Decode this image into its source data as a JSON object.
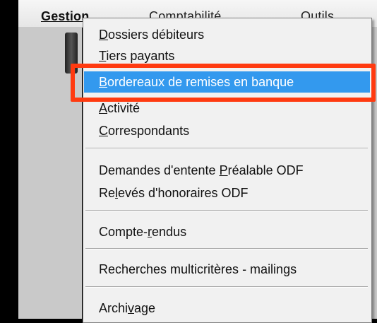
{
  "menubar": {
    "items": [
      {
        "label": "Gestion"
      },
      {
        "label": "Comptabilité"
      },
      {
        "label": "Outils"
      }
    ]
  },
  "menu": {
    "items": [
      {
        "label": "Dossiers débiteurs",
        "underline": "D"
      },
      {
        "label": "Tiers payants",
        "underline": "T"
      },
      {
        "label": "Bordereaux de remises en banque",
        "underline": "B",
        "selected": true
      },
      {
        "label": "Activité",
        "underline": "A"
      },
      {
        "label": "Correspondants",
        "underline": "C"
      },
      {
        "label": "Demandes d'entente Préalable ODF",
        "underline": "P"
      },
      {
        "label": "Relevés d'honoraires ODF",
        "underline": "l"
      },
      {
        "label": "Compte-rendus",
        "underline": "r"
      },
      {
        "label": "Recherches multicritères - mailings",
        "underline": ""
      },
      {
        "label": "Archivage",
        "underline": "v"
      }
    ]
  },
  "colors": {
    "selection": "#3399ee",
    "highlight_border": "#ff3a10"
  }
}
